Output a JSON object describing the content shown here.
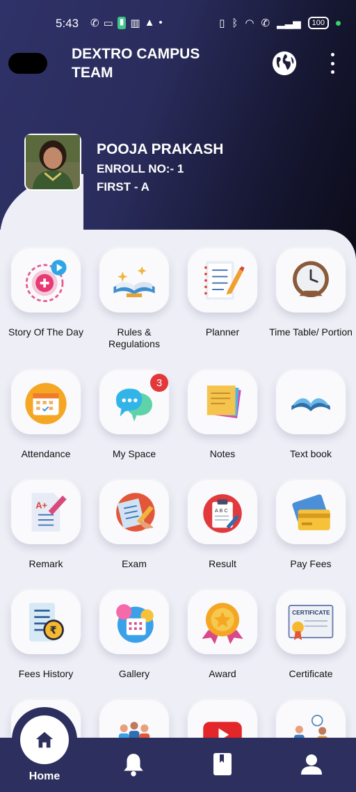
{
  "status_bar": {
    "time": "5:43",
    "battery": "100"
  },
  "header": {
    "title": "DEXTRO CAMPUS TEAM"
  },
  "profile": {
    "name": "POOJA PRAKASH",
    "enroll": "ENROLL NO:- 1",
    "class": "FIRST - A"
  },
  "menu": {
    "items": [
      {
        "label": "Story Of The Day",
        "icon": "story-icon"
      },
      {
        "label": "Rules & Regulations",
        "icon": "book-icon"
      },
      {
        "label": "Planner",
        "icon": "planner-icon"
      },
      {
        "label": "Time Table/ Portion",
        "icon": "clock-icon"
      },
      {
        "label": "Attendance",
        "icon": "calendar-icon"
      },
      {
        "label": "My Space",
        "icon": "chat-icon",
        "badge": "3"
      },
      {
        "label": "Notes",
        "icon": "notes-icon"
      },
      {
        "label": "Text book",
        "icon": "open-book-icon"
      },
      {
        "label": "Remark",
        "icon": "remark-icon"
      },
      {
        "label": "Exam",
        "icon": "exam-icon"
      },
      {
        "label": "Result",
        "icon": "result-icon"
      },
      {
        "label": "Pay Fees",
        "icon": "card-icon"
      },
      {
        "label": "Fees History",
        "icon": "fees-history-icon"
      },
      {
        "label": "Gallery",
        "icon": "gallery-icon"
      },
      {
        "label": "Award",
        "icon": "award-icon"
      },
      {
        "label": "Certificate",
        "icon": "certificate-icon"
      },
      {
        "label": "",
        "icon": "blank-icon"
      },
      {
        "label": "",
        "icon": "group-icon"
      },
      {
        "label": "",
        "icon": "youtube-icon"
      },
      {
        "label": "",
        "icon": "meeting-icon"
      }
    ]
  },
  "bottom_nav": {
    "home_label": "Home"
  }
}
